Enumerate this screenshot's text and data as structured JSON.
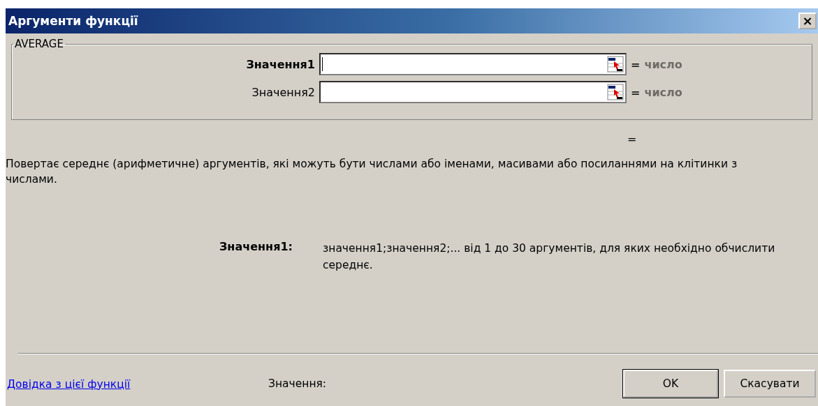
{
  "window": {
    "title": "Аргументи функції",
    "close": "×"
  },
  "function_group": {
    "legend": "AVERAGE",
    "fields": [
      {
        "label": "Значення1",
        "selected": true,
        "equals": "=",
        "result": "число"
      },
      {
        "label": "Значення2",
        "selected": false,
        "equals": "=",
        "result": "число"
      }
    ]
  },
  "formula_result": "=",
  "description": "Повертає середнє (арифметичне) аргументів, які можуть бути числами або іменами, масивами або посиланнями на клітинки з числами.",
  "argument_help": {
    "label": "Значення1:",
    "text": "значення1;значення2;... від 1 до 30 аргументів, для яких необхідно обчислити середнє."
  },
  "footer": {
    "help_link": "Довідка з цієї функції",
    "value_label": "Значення:",
    "buttons": [
      "OK",
      "Скасувати"
    ]
  }
}
